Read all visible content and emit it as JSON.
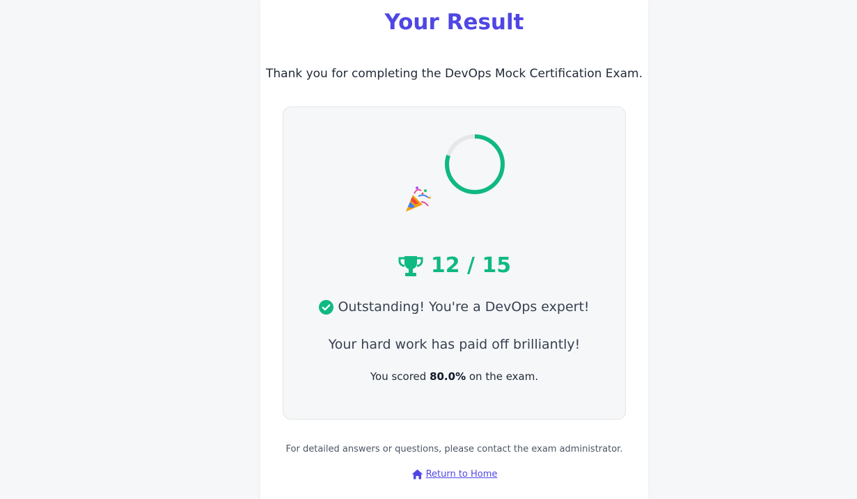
{
  "page": {
    "title": "Your Result",
    "intro": "Thank you for completing the DevOps Mock Certification Exam."
  },
  "result": {
    "score_text": "12 / 15",
    "score_correct": 12,
    "score_total": 15,
    "progress_fraction": 0.8,
    "status_message": "Outstanding! You're a DevOps expert!",
    "subline": "Your hard work has paid off brilliantly!",
    "percent_prefix": "You scored ",
    "percent_value": "80.0%",
    "percent_suffix": " on the exam."
  },
  "footer": {
    "note": "For detailed answers or questions, please contact the exam administrator.",
    "home_link_label": " Return to Home"
  },
  "icons": {
    "trophy": "trophy-icon",
    "check": "check-circle-icon",
    "home": "home-icon",
    "celebration": "party-popper-icon"
  },
  "colors": {
    "accent": "#4f46e5",
    "success": "#10b981",
    "ring_track": "#e5e7eb"
  }
}
